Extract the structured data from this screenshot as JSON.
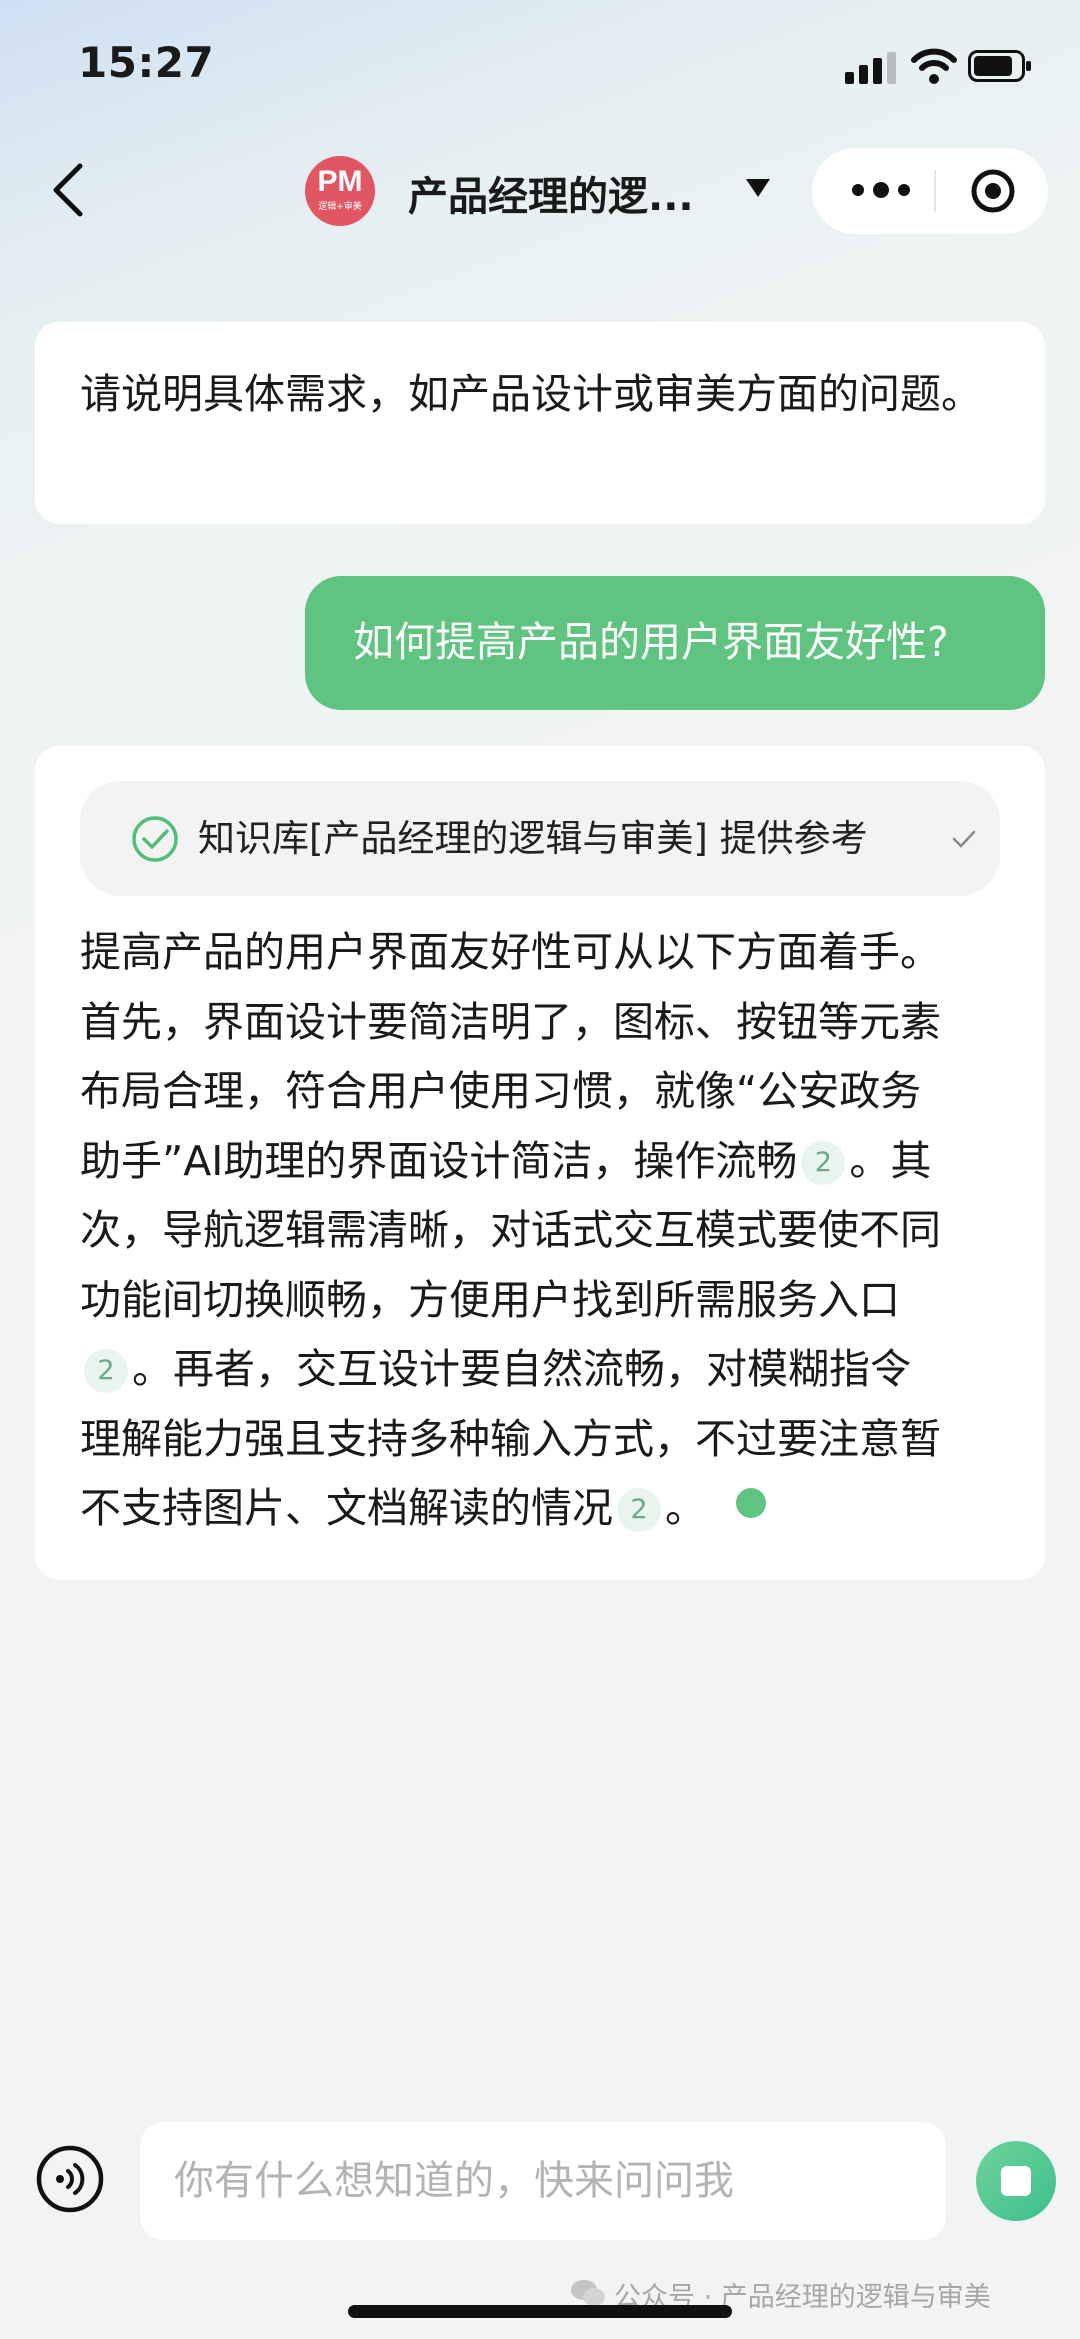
{
  "status_bar": {
    "time": "15:27"
  },
  "nav": {
    "avatar_text": "PM",
    "avatar_subtext": "逻辑+审美",
    "title": "产品经理的逻..."
  },
  "messages": {
    "bot_intro": "请说明具体需求，如产品设计或审美方面的问题。",
    "user_question": "如何提高产品的用户界面友好性?",
    "knowledge_source": "知识库[产品经理的逻辑与审美] 提供参考",
    "answer": {
      "line1": "提高产品的用户界面友好性可从以下方面着手。",
      "line2": "首先，界面设计要简洁明了，图标、按钮等元素",
      "line3": "布局合理，符合用户使用习惯，就像“公安政务",
      "line4a": "助手”AI助理的界面设计简洁，操作流畅",
      "line4b": "。其",
      "line5": "次，导航逻辑需清晰，对话式交互模式要使不同",
      "line6": "功能间切换顺畅，方便用户找到所需服务入口",
      "line7": "。再者，交互设计要自然流畅，对模糊指令",
      "line8": "理解能力强且支持多种输入方式，不过要注意暂",
      "line9a": "不支持图片、文档解读的情况",
      "line9b": "。",
      "citation": "2"
    }
  },
  "input": {
    "placeholder": "你有什么想知道的，快来问问我"
  },
  "footer": {
    "watermark": "公众号 · 产品经理的逻辑与审美"
  },
  "colors": {
    "accent_green": "#5fc47f",
    "avatar_red": "#e25663"
  }
}
